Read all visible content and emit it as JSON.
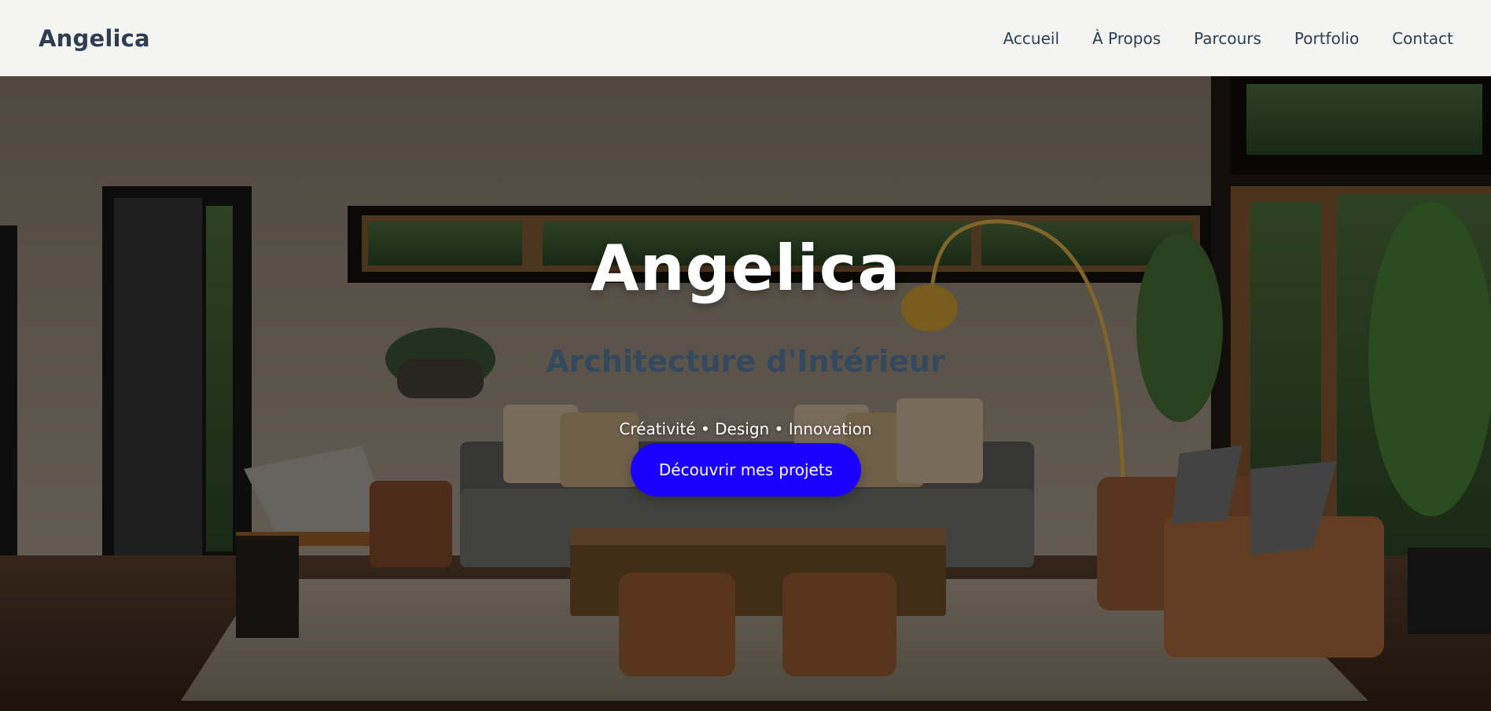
{
  "navbar": {
    "brand": "Angelica",
    "links": [
      "Accueil",
      "À Propos",
      "Parcours",
      "Portfolio",
      "Contact"
    ]
  },
  "hero": {
    "title": "Angelica",
    "subtitle": "Architecture d'Intérieur",
    "tagline": "Créativité • Design • Innovation",
    "cta_label": "Découvrir mes projets"
  },
  "colors": {
    "brand_text": "#2c3e50",
    "subtitle": "#34495e",
    "cta_background": "#1a00ff",
    "navbar_background": "#f4f4f3"
  }
}
